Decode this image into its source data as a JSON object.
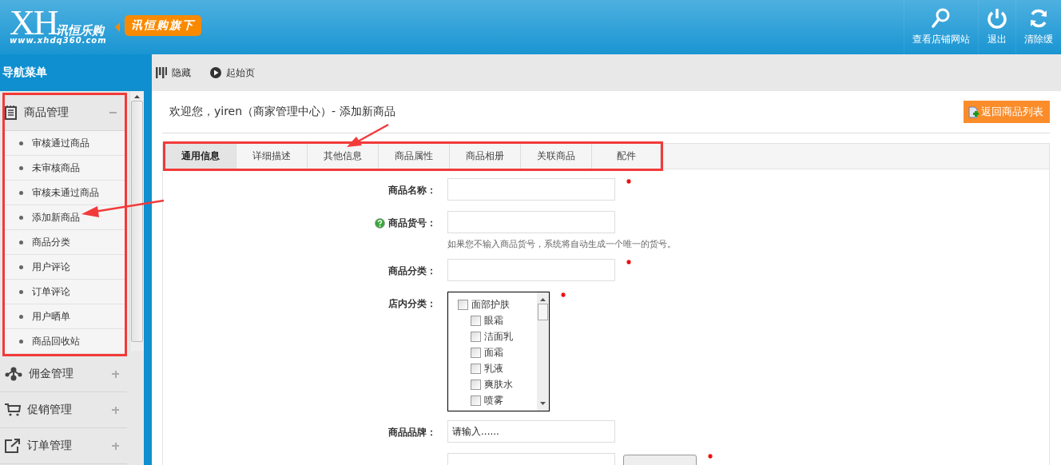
{
  "header": {
    "logo_letters": "XH",
    "logo_name": "讯恒乐购",
    "logo_url": "www.xhdq360.com",
    "badge": "讯恒购旗下",
    "actions": [
      {
        "label": "查看店铺网站"
      },
      {
        "label": "退出"
      },
      {
        "label": "清除缓"
      }
    ]
  },
  "sidebar": {
    "title": "导航菜单",
    "groups": [
      {
        "label": "商品管理",
        "expanded": true,
        "children": [
          {
            "label": "审核通过商品"
          },
          {
            "label": "未审核商品"
          },
          {
            "label": "审核未通过商品"
          },
          {
            "label": "添加新商品"
          },
          {
            "label": "商品分类"
          },
          {
            "label": "用户评论"
          },
          {
            "label": "订单评论"
          },
          {
            "label": "用户晒单"
          },
          {
            "label": "商品回收站"
          }
        ]
      },
      {
        "label": "佣金管理",
        "expanded": false
      },
      {
        "label": "促销管理",
        "expanded": false
      },
      {
        "label": "订单管理",
        "expanded": false
      }
    ]
  },
  "toolbar": [
    {
      "label": "隐藏"
    },
    {
      "label": "起始页"
    }
  ],
  "main": {
    "title": "欢迎您，yiren（商家管理中心）- 添加新商品",
    "back_button": "返回商品列表",
    "tabs": [
      {
        "label": "通用信息",
        "selected": true
      },
      {
        "label": "详细描述",
        "selected": false
      },
      {
        "label": "其他信息",
        "selected": false
      },
      {
        "label": "商品属性",
        "selected": false
      },
      {
        "label": "商品相册",
        "selected": false
      },
      {
        "label": "关联商品",
        "selected": false
      },
      {
        "label": "配件",
        "selected": false
      }
    ],
    "form": [
      {
        "kind": "text",
        "label": "商品名称：",
        "required": true,
        "help": false
      },
      {
        "kind": "text",
        "label": "商品货号：",
        "required": false,
        "help": true,
        "hint": "如果您不输入商品货号，系统将自动生成一个唯一的货号。"
      },
      {
        "kind": "text",
        "label": "商品分类：",
        "required": true,
        "help": false
      },
      {
        "kind": "listbox",
        "label": "店内分类：",
        "required": true,
        "help": false,
        "options": [
          {
            "label": "面部护肤",
            "checked": false,
            "children": [
              {
                "label": "眼霜",
                "checked": false
              },
              {
                "label": "洁面乳",
                "checked": false
              },
              {
                "label": "面霜",
                "checked": false
              },
              {
                "label": "乳液",
                "checked": false
              },
              {
                "label": "爽肤水",
                "checked": false
              },
              {
                "label": "喷雾",
                "checked": false
              }
            ]
          }
        ]
      },
      {
        "kind": "text",
        "label": "商品品牌：",
        "required": false,
        "help": false,
        "value": "请输入......"
      },
      {
        "kind": "text_button",
        "required": true,
        "help": false
      }
    ]
  },
  "annotations": {
    "highlight_boxes": true,
    "arrows": true
  }
}
